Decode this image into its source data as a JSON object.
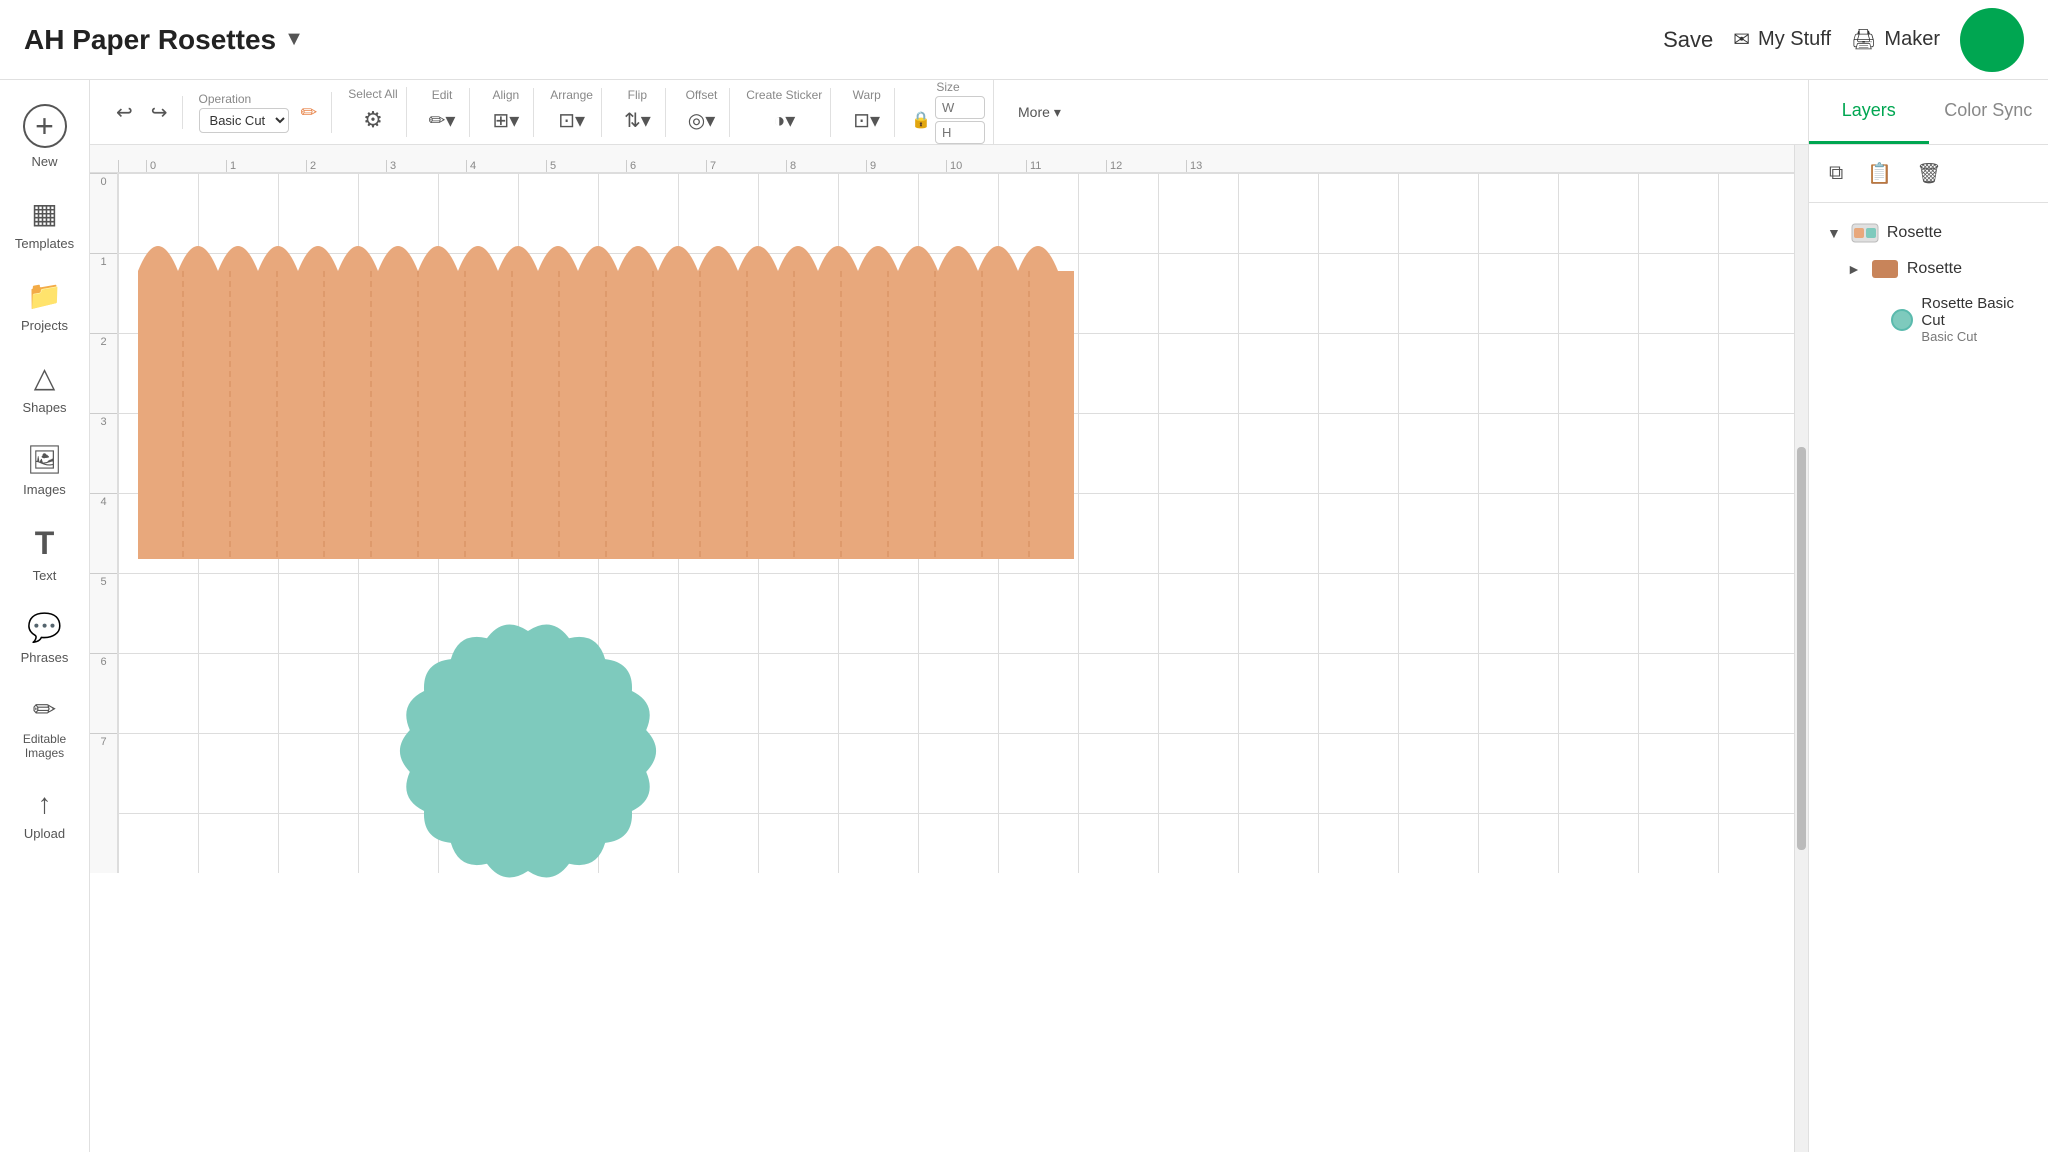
{
  "header": {
    "project_title": "AH Paper Rosettes",
    "save_label": "Save",
    "mystuff_label": "My Stuff",
    "maker_label": "Maker"
  },
  "sidebar": {
    "items": [
      {
        "id": "new",
        "label": "New",
        "icon": "+"
      },
      {
        "id": "templates",
        "label": "Templates",
        "icon": "▦"
      },
      {
        "id": "projects",
        "label": "Projects",
        "icon": "📁"
      },
      {
        "id": "shapes",
        "label": "Shapes",
        "icon": "△"
      },
      {
        "id": "images",
        "label": "Images",
        "icon": "🖼"
      },
      {
        "id": "text",
        "label": "Text",
        "icon": "T"
      },
      {
        "id": "phrases",
        "label": "Phrases",
        "icon": "💬"
      },
      {
        "id": "editable-images",
        "label": "Editable Images",
        "icon": "✏"
      },
      {
        "id": "upload",
        "label": "Upload",
        "icon": "↑"
      }
    ]
  },
  "toolbar": {
    "operation_label": "Operation",
    "operation_value": "Basic Cut",
    "select_all_label": "Select All",
    "edit_label": "Edit",
    "align_label": "Align",
    "arrange_label": "Arrange",
    "flip_label": "Flip",
    "offset_label": "Offset",
    "create_sticker_label": "Create Sticker",
    "warp_label": "Warp",
    "size_label": "Size",
    "size_w_placeholder": "W",
    "size_h_placeholder": "H",
    "more_label": "More"
  },
  "right_panel": {
    "tabs": [
      {
        "id": "layers",
        "label": "Layers",
        "active": true
      },
      {
        "id": "color-sync",
        "label": "Color Sync",
        "active": false
      }
    ],
    "layers": {
      "root": {
        "name": "Rosette",
        "children": [
          {
            "name": "Rosette",
            "thumb_color": "#c8845a",
            "children": [
              {
                "name": "Rosette Basic Cut",
                "color": "#7ecabd"
              }
            ]
          }
        ]
      }
    }
  },
  "ruler": {
    "top_marks": [
      "0",
      "1",
      "2",
      "3",
      "4",
      "5",
      "6",
      "7",
      "8",
      "9",
      "10",
      "11",
      "12",
      "13"
    ],
    "left_marks": [
      "0",
      "1",
      "2",
      "3",
      "4",
      "5",
      "6",
      "7"
    ]
  },
  "colors": {
    "accent": "#00a651",
    "rosette_strip": "#e8a87c",
    "rosette_circle": "#7ecabd",
    "header_border": "#e0e0e0"
  }
}
